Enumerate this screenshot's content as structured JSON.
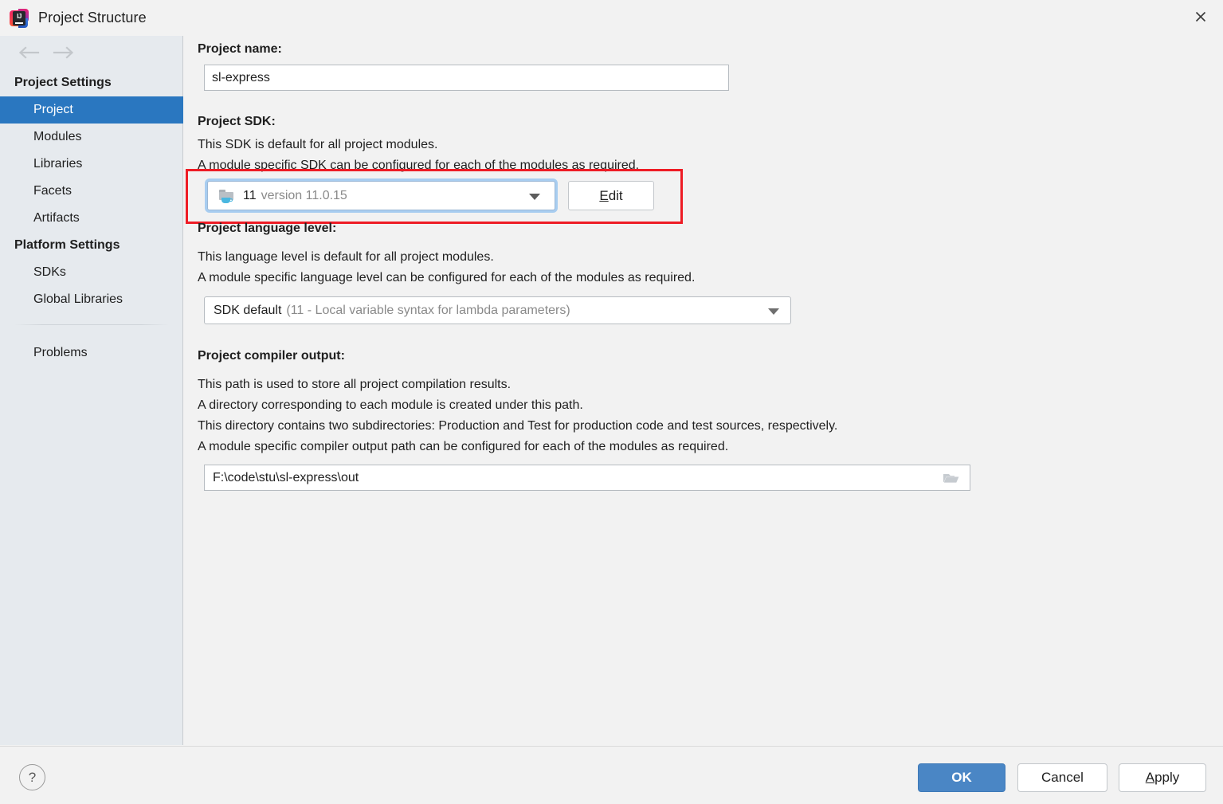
{
  "window": {
    "title": "Project Structure",
    "logo_text": "IJ",
    "close_label": "×"
  },
  "nav": {
    "back_icon": "arrow-left-icon",
    "forward_icon": "arrow-right-icon"
  },
  "sidebar": {
    "groups": [
      {
        "title": "Project Settings",
        "items": [
          {
            "label": "Project",
            "selected": true
          },
          {
            "label": "Modules",
            "selected": false
          },
          {
            "label": "Libraries",
            "selected": false
          },
          {
            "label": "Facets",
            "selected": false
          },
          {
            "label": "Artifacts",
            "selected": false
          }
        ]
      },
      {
        "title": "Platform Settings",
        "items": [
          {
            "label": "SDKs",
            "selected": false
          },
          {
            "label": "Global Libraries",
            "selected": false
          }
        ]
      }
    ],
    "extra_items": [
      {
        "label": "Problems",
        "selected": false
      }
    ]
  },
  "main": {
    "project_name": {
      "label": "Project name:",
      "value": "sl-express"
    },
    "project_sdk": {
      "label": "Project SDK:",
      "description_lines": [
        "This SDK is default for all project modules.",
        "A module specific SDK can be configured for each of the modules as required."
      ],
      "selected_name": "11",
      "selected_version": "version 11.0.15",
      "icon": "java-sdk-folder-icon",
      "edit_button_accel": "E",
      "edit_button_rest": "dit",
      "highlight_color": "#ee1c25",
      "focus_ring_color": "#a8cdf0"
    },
    "language_level": {
      "label": "Project language level:",
      "description_lines": [
        "This language level is default for all project modules.",
        "A module specific language level can be configured for each of the modules as required."
      ],
      "selected_primary": "SDK default",
      "selected_secondary": "(11 - Local variable syntax for lambda parameters)"
    },
    "compiler_output": {
      "label": "Project compiler output:",
      "description_lines": [
        "This path is used to store all project compilation results.",
        "A directory corresponding to each module is created under this path.",
        "This directory contains two subdirectories: Production and Test for production code and test sources, respectively.",
        "A module specific compiler output path can be configured for each of the modules as required."
      ],
      "path_value": "F:\\code\\stu\\sl-express\\out",
      "browse_icon": "folder-browse-icon"
    }
  },
  "footer": {
    "help_label": "?",
    "ok_label": "OK",
    "cancel_label": "Cancel",
    "apply_accel": "A",
    "apply_rest": "pply",
    "ok_color": "#4a86c5"
  }
}
